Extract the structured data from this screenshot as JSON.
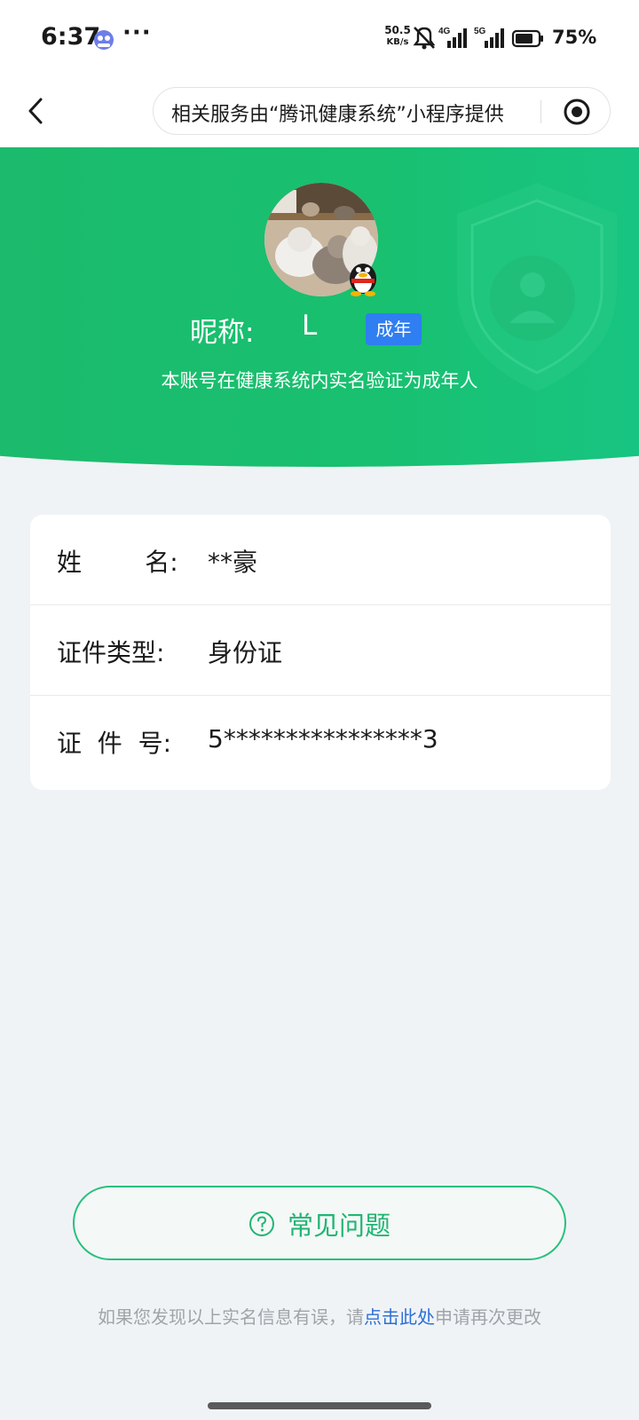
{
  "status_bar": {
    "time": "6:37",
    "dots": "···",
    "net_speed_value": "50.5",
    "net_speed_unit": "KB/s",
    "battery": "75%",
    "net_4g": "4G",
    "net_5g": "5G"
  },
  "nav": {
    "capsule_text": "相关服务由“腾讯健康系统”小程序提供"
  },
  "profile": {
    "nickname_label": "昵称:",
    "nickname_value": "L",
    "age_badge": "成年",
    "verify_text": "本账号在健康系统内实名验证为成年人"
  },
  "info": {
    "rows": [
      {
        "label": "姓        名:",
        "value": "**豪"
      },
      {
        "label": "证件类型:",
        "value": "身份证"
      },
      {
        "label": "证  件  号:",
        "value": "5****************3"
      }
    ]
  },
  "faq": {
    "label": "常见问题"
  },
  "footer": {
    "note_prefix": "如果您发现以上实名信息有误，请",
    "note_link": "点击此处",
    "note_suffix": "申请再次更改"
  },
  "colors": {
    "primary_green": "#1db86b",
    "badge_blue": "#2f7ef2",
    "link_blue": "#2c6fd7"
  }
}
